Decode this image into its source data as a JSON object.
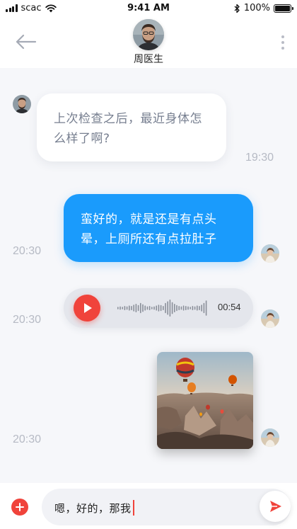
{
  "status_bar": {
    "carrier": "scac",
    "time": "9:41 AM",
    "battery": "100%",
    "battery_level": 1.0
  },
  "header": {
    "contact_name": "周医生",
    "back_icon": "arrow-left-icon",
    "more_icon": "more-vertical-icon"
  },
  "messages": [
    {
      "side": "incoming",
      "type": "text",
      "text": "上次检查之后，最近身体怎么样了啊?",
      "time": "19:30"
    },
    {
      "side": "outgoing",
      "type": "text",
      "text": "蛮好的，就是还是有点头晕，上厕所还有点拉肚子",
      "time": "20:30"
    },
    {
      "side": "outgoing",
      "type": "voice",
      "duration": "00:54",
      "time": "20:30"
    },
    {
      "side": "outgoing",
      "type": "image",
      "image_subject": "hot air balloons over rocky valley",
      "time": "20:30"
    }
  ],
  "composer": {
    "value": "嗯，好的，那我",
    "add_icon": "plus-circle-icon",
    "send_icon": "send-icon"
  },
  "colors": {
    "accent_blue": "#1a9bfc",
    "accent_red": "#f0433b",
    "background": "#f6f7fa"
  }
}
